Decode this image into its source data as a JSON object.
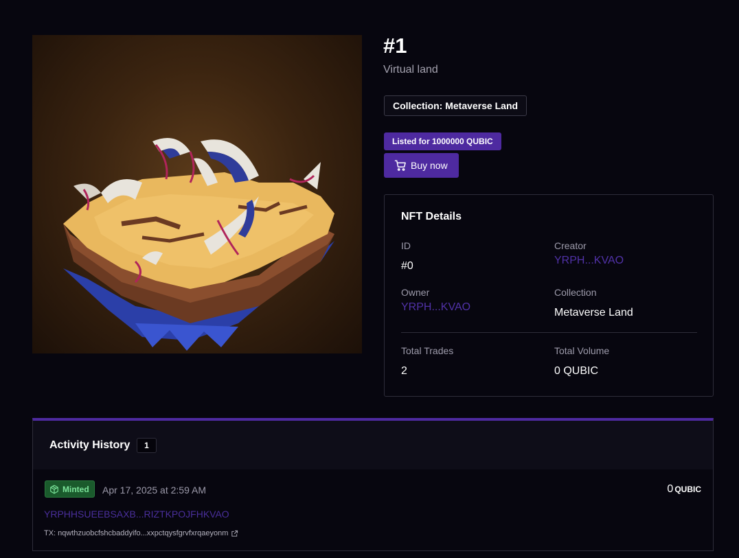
{
  "nft": {
    "title": "#1",
    "subtitle": "Virtual land",
    "collection_badge": "Collection: Metaverse Land",
    "listed_badge": "Listed for 1000000 QUBIC",
    "buy_label": "Buy now"
  },
  "details": {
    "title": "NFT Details",
    "id_label": "ID",
    "id_value": "#0",
    "creator_label": "Creator",
    "creator_value": "YRPH...KVAO",
    "owner_label": "Owner",
    "owner_value": "YRPH...KVAO",
    "collection_label": "Collection",
    "collection_value": "Metaverse Land",
    "trades_label": "Total Trades",
    "trades_value": "2",
    "volume_label": "Total Volume",
    "volume_value": "0 QUBIC"
  },
  "activity": {
    "title": "Activity History",
    "count": "1",
    "events": [
      {
        "type": "Minted",
        "date": "Apr 17, 2025 at 2:59 AM",
        "amount": "0",
        "currency": "QUBIC",
        "address": "YRPHHSUEEBSAXB...RIZTKPOJFHKVAO",
        "tx": "TX: nqwthzuobcfshcbaddyifo...xxpctqysfgrvfxrqaeyonm"
      }
    ]
  },
  "colors": {
    "accent": "#4e2aa0",
    "background": "#07060f",
    "link": "#5132a8",
    "minted_green": "#1a5a2c"
  },
  "icons": {
    "buy": "cart-icon",
    "minted": "box-icon",
    "tx": "external-link-icon"
  }
}
